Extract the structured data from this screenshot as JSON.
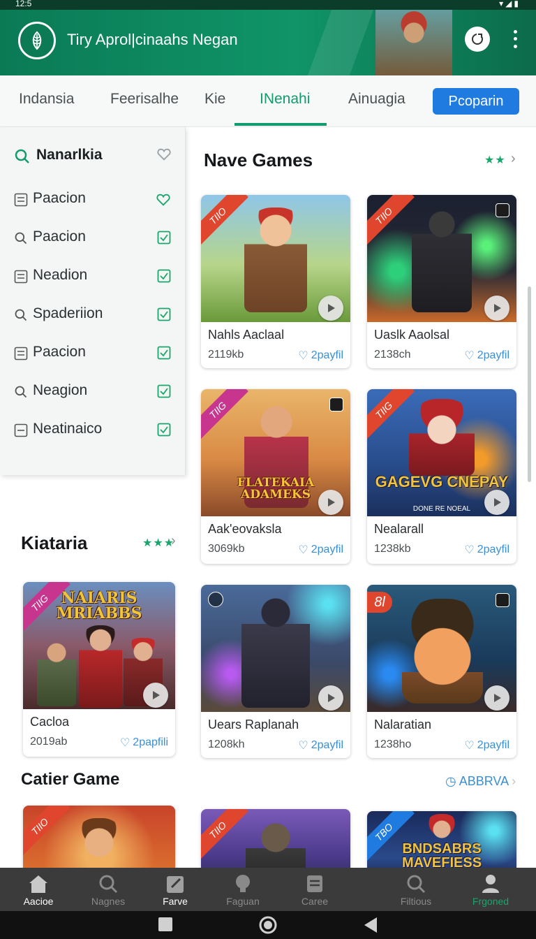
{
  "status_bar": {
    "time": "12:5",
    "icons": "▾◢▮"
  },
  "app_bar": {
    "title": "Tiry Aprol|cinaahs Negan"
  },
  "tabs": [
    {
      "label": "Indansia"
    },
    {
      "label": "Feerisalhe"
    },
    {
      "label": "Kie"
    },
    {
      "label": "INenahi",
      "active": true
    },
    {
      "label": "Ainuagia"
    }
  ],
  "tab_button": {
    "label": "Pcoparin"
  },
  "sidebar": {
    "search_label": "Nanarlkia",
    "items": [
      {
        "label": "Paacion",
        "icon": "list-icon",
        "mark": "heart-icon"
      },
      {
        "label": "Paacion",
        "icon": "search-icon",
        "mark": "check-icon"
      },
      {
        "label": "Neadion",
        "icon": "list-icon",
        "mark": "check-icon"
      },
      {
        "label": "Spaderiion",
        "icon": "search-icon",
        "mark": "check-icon"
      },
      {
        "label": "Paacion",
        "icon": "list-icon",
        "mark": "check-icon"
      },
      {
        "label": "Neagion",
        "icon": "search-icon",
        "mark": "check-icon"
      },
      {
        "label": "Neatinaico",
        "icon": "list-icon",
        "mark": "check-icon"
      }
    ]
  },
  "sections": {
    "new_games": {
      "title": "Nave Games",
      "stars": "★★"
    },
    "kiataria": {
      "title": "Kiataria",
      "stars": "★★★"
    },
    "catier": {
      "title": "Catier Game",
      "see_all": "ABBRVA"
    }
  },
  "cards": [
    {
      "name": "Nahls Aaclaal",
      "size": "2119kb",
      "likes": "2payfil",
      "ribbon": "TIIO",
      "ribbon_color": "#e0452d"
    },
    {
      "name": "Uaslk Aaolsal",
      "size": "2138ch",
      "likes": "2payfil",
      "ribbon": "TIIO",
      "ribbon_color": "#e0452d"
    },
    {
      "name": "Aak'eovaksla",
      "size": "3069kb",
      "likes": "2payfil",
      "ribbon": "TIIG",
      "ribbon_color": "#c8358f",
      "art_text": "FLATEKAIA ADAMEKS"
    },
    {
      "name": "Nealarall",
      "size": "1238kb",
      "likes": "2payfil",
      "ribbon": "TIIG",
      "ribbon_color": "#e0452d",
      "art_text": "GAGEVG CNEPAY",
      "art_sub": "DONE RE NOEAL"
    },
    {
      "name": "Cacloa",
      "size": "2019ab",
      "likes": "2papfili",
      "ribbon": "TIIG",
      "ribbon_color": "#c8358f",
      "art_text": "NAIARIS MRIABBS"
    },
    {
      "name": "Uears Raplanah",
      "size": "1208kh",
      "likes": "2payfil",
      "ribbon": ""
    },
    {
      "name": "Nalaratian",
      "size": "1238ho",
      "likes": "2payfil",
      "ribbon": "8l",
      "ribbon_color": "#e0452d"
    },
    {
      "name": "",
      "size": "",
      "likes": "",
      "ribbon": "TIIO",
      "ribbon_color": "#e0452d"
    },
    {
      "name": "",
      "size": "",
      "likes": "",
      "ribbon": "TIIO",
      "ribbon_color": "#e0452d"
    },
    {
      "name": "",
      "size": "",
      "likes": "",
      "ribbon": "TBO",
      "ribbon_color": "#1f7be0",
      "art_text": "BNDSABRS MAVEFIESS"
    }
  ],
  "bottom_nav": [
    {
      "label": "Aacioe",
      "icon": "home-icon",
      "state": "active"
    },
    {
      "label": "Nagnes",
      "icon": "search-icon",
      "state": ""
    },
    {
      "label": "Farve",
      "icon": "edit-icon",
      "state": "active"
    },
    {
      "label": "Faguan",
      "icon": "bulb-icon",
      "state": ""
    },
    {
      "label": "Caree",
      "icon": "list-icon",
      "state": ""
    },
    {
      "label": "Filtious",
      "icon": "search-icon",
      "state": ""
    },
    {
      "label": "Frgoned",
      "icon": "profile-icon",
      "state": "green"
    }
  ],
  "colors": {
    "brand_green": "#109468",
    "accent_blue": "#1f7be0",
    "link_blue": "#3a8fd8"
  }
}
